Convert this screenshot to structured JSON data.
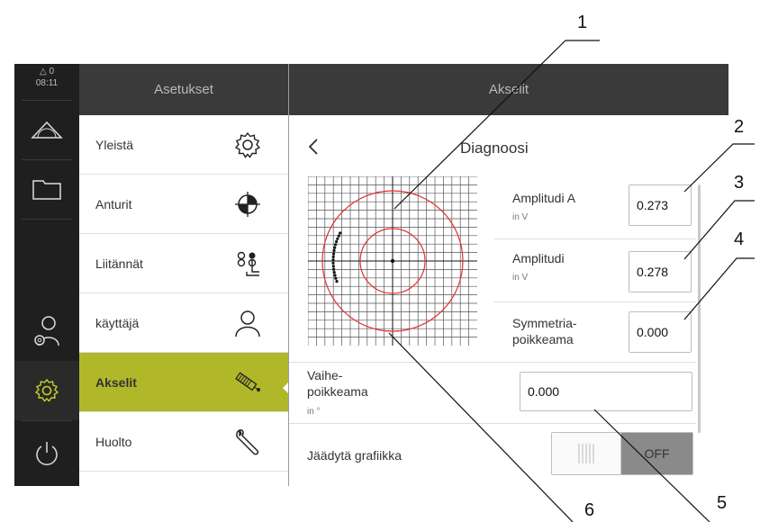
{
  "status": {
    "warnings": "△ 0",
    "time": "08:11"
  },
  "settings": {
    "title": "Asetukset",
    "items": [
      {
        "label": "Yleistä",
        "icon": "gear-icon"
      },
      {
        "label": "Anturit",
        "icon": "sensor-icon"
      },
      {
        "label": "Liitännät",
        "icon": "connections-icon"
      },
      {
        "label": "käyttäjä",
        "icon": "user-icon"
      },
      {
        "label": "Akselit",
        "icon": "axis-icon",
        "active": true
      },
      {
        "label": "Huolto",
        "icon": "wrench-icon"
      }
    ]
  },
  "main": {
    "title": "Akselit",
    "subtitle": "Diagnoosi",
    "fields": {
      "amp_a": {
        "label": "Amplitudi A",
        "unit": "in V",
        "value": "0.273"
      },
      "amp_b": {
        "label": "Amplitudi",
        "unit": "in V",
        "value": "0.278"
      },
      "sym": {
        "label1": "Symmetria-",
        "label2": "poikkeama",
        "value": "0.000"
      },
      "phase": {
        "label1": "Vaihe-",
        "label2": "poikkeama",
        "unit": "in °",
        "value": "0.000"
      }
    },
    "freeze": {
      "label": "Jäädytä grafiikka",
      "state": "OFF"
    }
  },
  "callouts": [
    "1",
    "2",
    "3",
    "4",
    "5",
    "6"
  ],
  "colors": {
    "accent": "#b0b82a",
    "dark": "#1f1f1f",
    "header": "#3a3a3a",
    "circle": "#e03030"
  }
}
